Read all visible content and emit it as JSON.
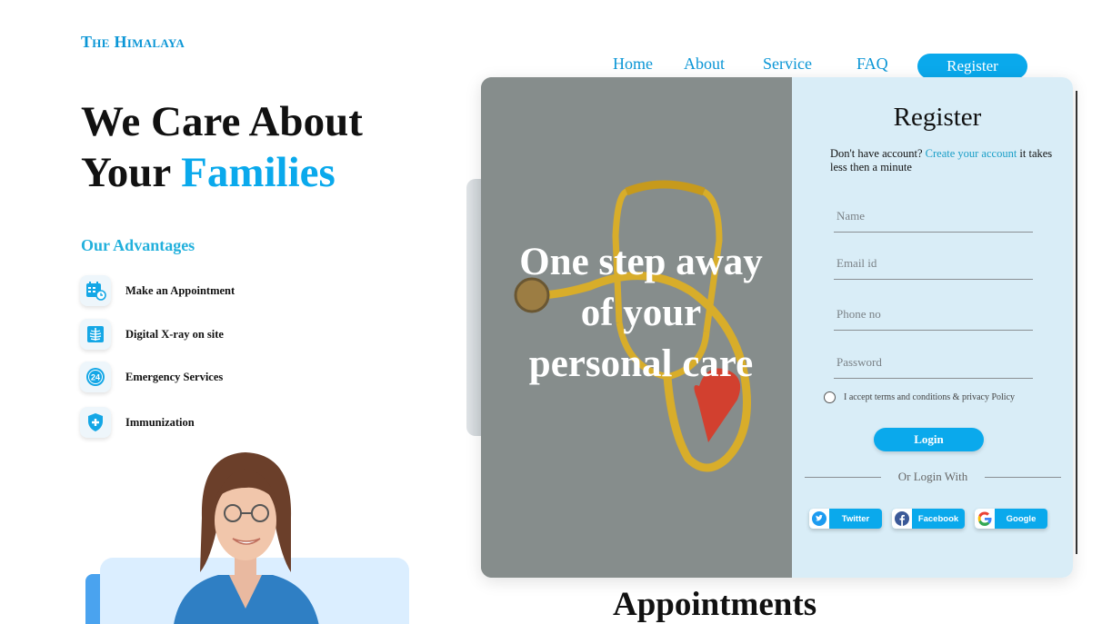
{
  "brand": "The Himalaya",
  "nav": {
    "home": "Home",
    "about": "About",
    "service": "Service",
    "faq": "FAQ",
    "register": "Register"
  },
  "hero": {
    "line1": "We Care About",
    "line2_prefix": "Your",
    "line2_accent": "Families"
  },
  "advantages": {
    "title": "Our Advantages",
    "items": [
      {
        "label": "Make an Appointment",
        "icon": "calendar-clock-icon"
      },
      {
        "label": "Digital X-ray on site",
        "icon": "xray-icon"
      },
      {
        "label": "Emergency Services",
        "icon": "24-hour-icon"
      },
      {
        "label": "Immunization",
        "icon": "shield-plus-icon"
      }
    ]
  },
  "appointments_heading": "Appointments",
  "modal": {
    "tagline": "One step away of your personal care",
    "title": "Register",
    "subtitle_prefix": "Don't have account?",
    "subtitle_link": "Create your account",
    "subtitle_suffix": "it takes less then a minute",
    "fields": {
      "name": "Name",
      "email": "Email id",
      "phone": "Phone no",
      "password": "Password"
    },
    "terms": "I accept terms and conditions & privacy Policy",
    "login": "Login",
    "or_login_with": "Or Login With",
    "social": {
      "twitter": "Twitter",
      "facebook": "Facebook",
      "google": "Google"
    }
  },
  "colors": {
    "accent": "#0aa9ec",
    "panel": "#d9edf7",
    "photo_bg": "#848b8a"
  }
}
